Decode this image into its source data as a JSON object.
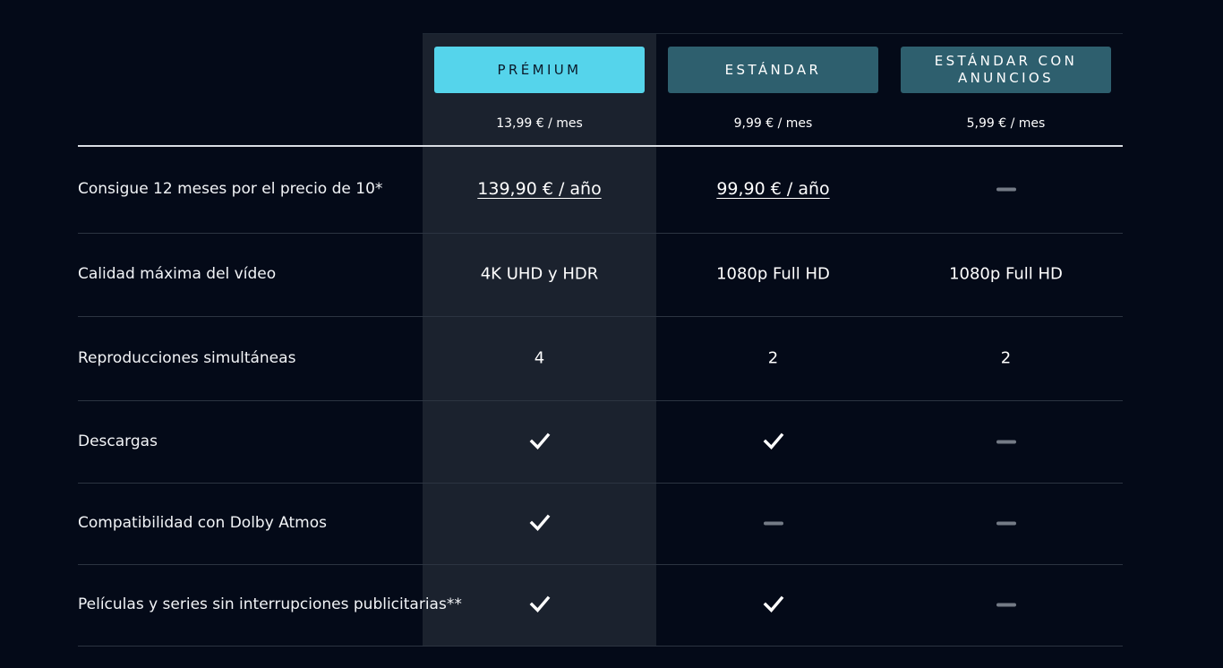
{
  "plans": [
    {
      "name": "PRÉMIUM",
      "price": "13,99 € / mes",
      "selected": true
    },
    {
      "name": "ESTÁNDAR",
      "price": "9,99 € / mes",
      "selected": false
    },
    {
      "name": "ESTÁNDAR CON ANUNCIOS",
      "price": "5,99 € / mes",
      "selected": false
    }
  ],
  "rows": [
    {
      "label": "Consigue 12 meses por el precio de 10*",
      "cells": [
        "139,90 € / año",
        "99,90 € / año",
        "none"
      ]
    },
    {
      "label": "Calidad máxima del vídeo",
      "cells": [
        "4K UHD y HDR",
        "1080p Full HD",
        "1080p Full HD"
      ]
    },
    {
      "label": "Reproducciones simultáneas",
      "cells": [
        "4",
        "2",
        "2"
      ]
    },
    {
      "label": "Descargas",
      "cells": [
        "check",
        "check",
        "none"
      ]
    },
    {
      "label": "Compatibilidad con Dolby Atmos",
      "cells": [
        "check",
        "none",
        "none"
      ]
    },
    {
      "label": "Películas y series sin interrupciones publicitarias**",
      "cells": [
        "check",
        "check",
        "none"
      ]
    }
  ],
  "icons": {
    "included": "checkmark-icon",
    "not_included": "dash-icon"
  },
  "colors": {
    "background": "#040a18",
    "selected_plan": "#55d4eb",
    "other_plan": "#2e5f6e",
    "highlight_column": "#1b222e"
  }
}
